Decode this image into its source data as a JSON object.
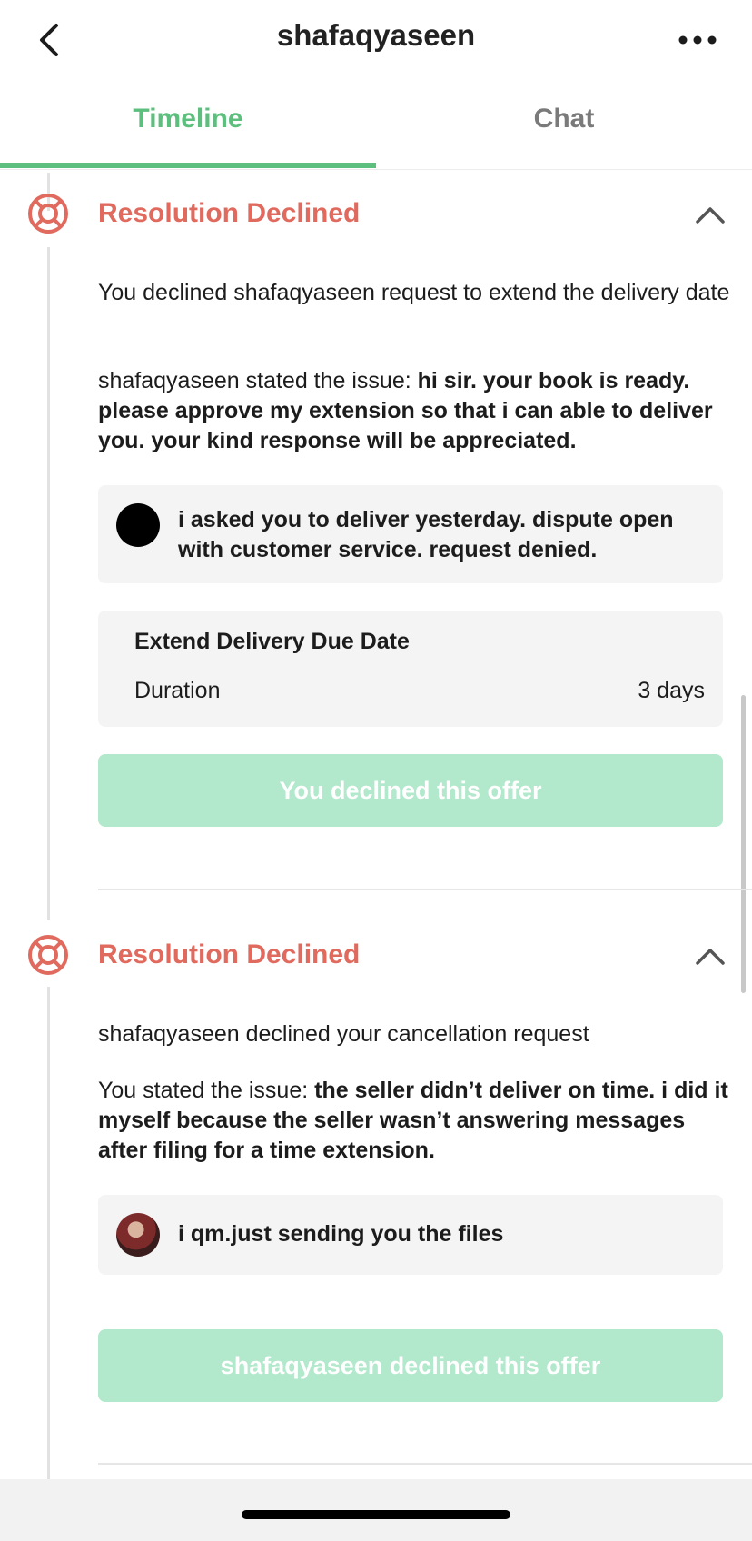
{
  "header": {
    "title": "shafaqyaseen"
  },
  "tabs": [
    {
      "label": "Timeline"
    },
    {
      "label": "Chat"
    }
  ],
  "sections": [
    {
      "title": "Resolution Declined",
      "summary": "You declined shafaqyaseen request to extend the delivery date",
      "issue_prefix": "shafaqyaseen stated the issue: ",
      "issue_text": "hi sir. your book is ready. please approve my extension so that i can able to deliver you. your kind response will be appreciated.",
      "reply": "i asked you to deliver yesterday. dispute open with customer service. request denied.",
      "offer": {
        "title": "Extend Delivery Due Date",
        "label": "Duration",
        "value": "3 days"
      },
      "status": "You declined this offer"
    },
    {
      "title": "Resolution Declined",
      "summary": "shafaqyaseen declined your cancellation request",
      "issue_prefix": "You stated the issue: ",
      "issue_text": "the seller didn’t deliver on time. i did it myself because the seller wasn’t answering messages after filing for a time extension.",
      "reply": "i qm.just sending you the files",
      "status": "shafaqyaseen declined this offer"
    }
  ],
  "colors": {
    "accent": "#5cbf7d",
    "declined": "#e06a5e",
    "button_disabled": "#b2e8cb"
  }
}
